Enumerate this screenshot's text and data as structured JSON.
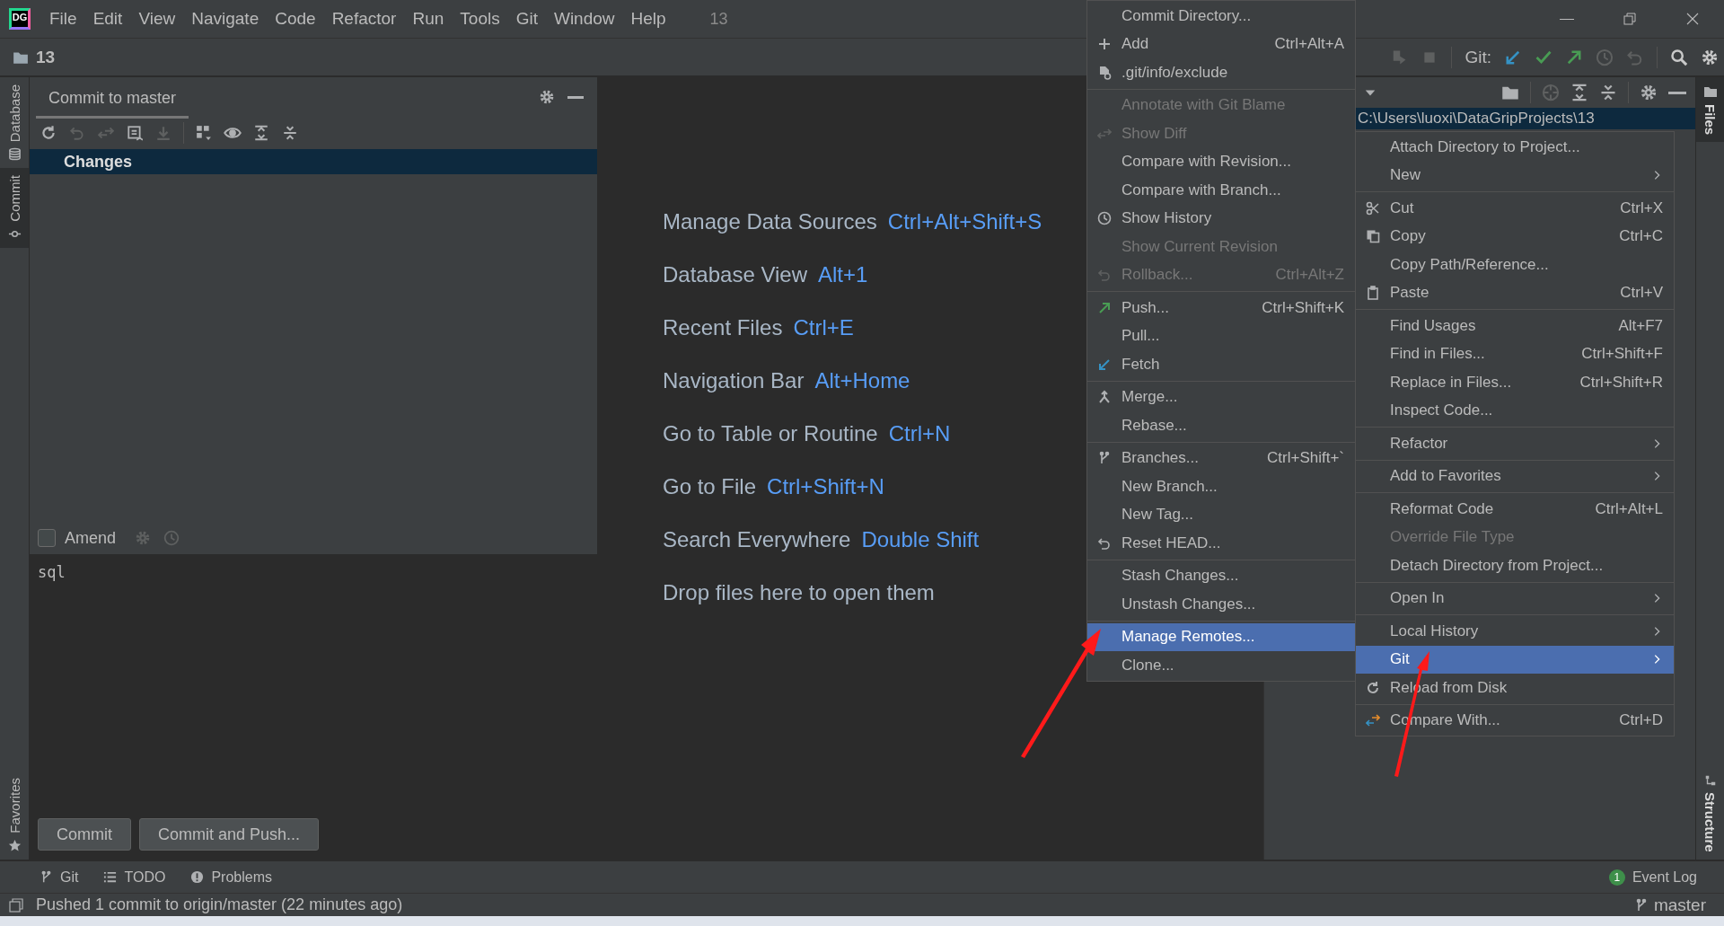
{
  "menu_bar": {
    "logo": "DG",
    "items": [
      "File",
      "Edit",
      "View",
      "Navigate",
      "Code",
      "Refactor",
      "Run",
      "Tools",
      "Git",
      "Window",
      "Help"
    ],
    "title": "13"
  },
  "nav_bar": {
    "project": "13",
    "vcs_label": "Git:"
  },
  "left_stripe": [
    {
      "label": "Database",
      "kind": "database",
      "selected": false
    },
    {
      "label": "Commit",
      "kind": "commit",
      "selected": true
    }
  ],
  "left_stripe_bottom": [
    {
      "label": "Favorites",
      "kind": "star",
      "selected": false
    }
  ],
  "commit_panel": {
    "tab": "Commit to master",
    "changes": {
      "label": "Changes",
      "selected": true
    },
    "amend": {
      "label": "Amend",
      "checked": false
    },
    "message": "sql",
    "buttons": [
      "Commit",
      "Commit and Push..."
    ]
  },
  "welcome": [
    {
      "label": "Manage Data Sources",
      "shortcut": "Ctrl+Alt+Shift+S"
    },
    {
      "label": "Database View",
      "shortcut": "Alt+1"
    },
    {
      "label": "Recent Files",
      "shortcut": "Ctrl+E"
    },
    {
      "label": "Navigation Bar",
      "shortcut": "Alt+Home"
    },
    {
      "label": "Go to Table or Routine",
      "shortcut": "Ctrl+N"
    },
    {
      "label": "Go to File",
      "shortcut": "Ctrl+Shift+N"
    },
    {
      "label": "Search Everywhere",
      "shortcut": "Double Shift"
    },
    {
      "label": "Drop files here to open them"
    }
  ],
  "project_panel": {
    "path": "C:\\Users\\luoxi\\DataGripProjects\\13",
    "path_selected": true
  },
  "right_stripe": [
    {
      "label": "Files",
      "kind": "folder",
      "selected": true
    }
  ],
  "right_stripe_bottom": [
    {
      "label": "Structure",
      "kind": "structure",
      "selected": false
    }
  ],
  "git_menu": [
    [
      {
        "label": "Commit Directory...",
        "disabled": false,
        "selected": false
      },
      {
        "label": "Add",
        "kind": "plus",
        "shortcut": "Ctrl+Alt+A",
        "disabled": false,
        "selected": false
      },
      {
        "label": ".git/info/exclude",
        "kind": "exclude",
        "disabled": false,
        "selected": false
      }
    ],
    [
      {
        "label": "Annotate with Git Blame",
        "disabled": true,
        "selected": false
      },
      {
        "label": "Show Diff",
        "kind": "diff",
        "disabled": true,
        "selected": false
      },
      {
        "label": "Compare with Revision...",
        "disabled": false,
        "selected": false
      },
      {
        "label": "Compare with Branch...",
        "disabled": false,
        "selected": false
      },
      {
        "label": "Show History",
        "kind": "clock",
        "disabled": false,
        "selected": false
      },
      {
        "label": "Show Current Revision",
        "disabled": true,
        "selected": false
      },
      {
        "label": "Rollback...",
        "kind": "undo",
        "shortcut": "Ctrl+Alt+Z",
        "disabled": true,
        "selected": false
      }
    ],
    [
      {
        "label": "Push...",
        "kind": "push",
        "shortcut": "Ctrl+Shift+K",
        "disabled": false,
        "selected": false
      },
      {
        "label": "Pull...",
        "disabled": false,
        "selected": false
      },
      {
        "label": "Fetch",
        "kind": "fetch",
        "disabled": false,
        "selected": false
      }
    ],
    [
      {
        "label": "Merge...",
        "kind": "merge",
        "disabled": false,
        "selected": false
      },
      {
        "label": "Rebase...",
        "disabled": false,
        "selected": false
      }
    ],
    [
      {
        "label": "Branches...",
        "kind": "branch",
        "shortcut": "Ctrl+Shift+`",
        "disabled": false,
        "selected": false
      },
      {
        "label": "New Branch...",
        "disabled": false,
        "selected": false
      },
      {
        "label": "New Tag...",
        "disabled": false,
        "selected": false
      },
      {
        "label": "Reset HEAD...",
        "kind": "undo",
        "disabled": false,
        "selected": false
      }
    ],
    [
      {
        "label": "Stash Changes...",
        "disabled": false,
        "selected": false
      },
      {
        "label": "Unstash Changes...",
        "disabled": false,
        "selected": false
      }
    ],
    [
      {
        "label": "Manage Remotes...",
        "disabled": false,
        "selected": true
      },
      {
        "label": "Clone...",
        "disabled": false,
        "selected": false
      }
    ]
  ],
  "context_menu": [
    [
      {
        "label": "Attach Directory to Project...",
        "disabled": false,
        "selected": false,
        "submenu": false
      },
      {
        "label": "New",
        "disabled": false,
        "selected": false,
        "submenu": true
      }
    ],
    [
      {
        "label": "Cut",
        "kind": "scissors",
        "shortcut": "Ctrl+X",
        "disabled": false,
        "selected": false,
        "submenu": false
      },
      {
        "label": "Copy",
        "kind": "copy",
        "shortcut": "Ctrl+C",
        "disabled": false,
        "selected": false,
        "submenu": false
      },
      {
        "label": "Copy Path/Reference...",
        "disabled": false,
        "selected": false,
        "submenu": false
      },
      {
        "label": "Paste",
        "kind": "paste",
        "shortcut": "Ctrl+V",
        "disabled": false,
        "selected": false,
        "submenu": false
      }
    ],
    [
      {
        "label": "Find Usages",
        "shortcut": "Alt+F7",
        "disabled": false,
        "selected": false,
        "submenu": false
      },
      {
        "label": "Find in Files...",
        "shortcut": "Ctrl+Shift+F",
        "disabled": false,
        "selected": false,
        "submenu": false
      },
      {
        "label": "Replace in Files...",
        "shortcut": "Ctrl+Shift+R",
        "disabled": false,
        "selected": false,
        "submenu": false
      },
      {
        "label": "Inspect Code...",
        "disabled": false,
        "selected": false,
        "submenu": false
      }
    ],
    [
      {
        "label": "Refactor",
        "disabled": false,
        "selected": false,
        "submenu": true
      }
    ],
    [
      {
        "label": "Add to Favorites",
        "disabled": false,
        "selected": false,
        "submenu": true
      }
    ],
    [
      {
        "label": "Reformat Code",
        "shortcut": "Ctrl+Alt+L",
        "disabled": false,
        "selected": false,
        "submenu": false
      },
      {
        "label": "Override File Type",
        "disabled": true,
        "selected": false,
        "submenu": false
      },
      {
        "label": "Detach Directory from Project...",
        "disabled": false,
        "selected": false,
        "submenu": false
      }
    ],
    [
      {
        "label": "Open In",
        "disabled": false,
        "selected": false,
        "submenu": true
      }
    ],
    [
      {
        "label": "Local History",
        "disabled": false,
        "selected": false,
        "submenu": true
      },
      {
        "label": "Git",
        "disabled": false,
        "selected": true,
        "submenu": true
      },
      {
        "label": "Reload from Disk",
        "kind": "reload",
        "disabled": false,
        "selected": false,
        "submenu": false
      }
    ],
    [
      {
        "label": "Compare With...",
        "kind": "compare",
        "shortcut": "Ctrl+D",
        "disabled": false,
        "selected": false,
        "submenu": false
      }
    ]
  ],
  "tool_bar": [
    {
      "label": "Git",
      "kind": "branch"
    },
    {
      "label": "TODO",
      "kind": "list"
    },
    {
      "label": "Problems",
      "kind": "problem"
    }
  ],
  "event_log": {
    "label": "Event Log",
    "count": "1"
  },
  "status_bar": {
    "message": "Pushed 1 commit to origin/master (22 minutes ago)",
    "branch": "master"
  }
}
